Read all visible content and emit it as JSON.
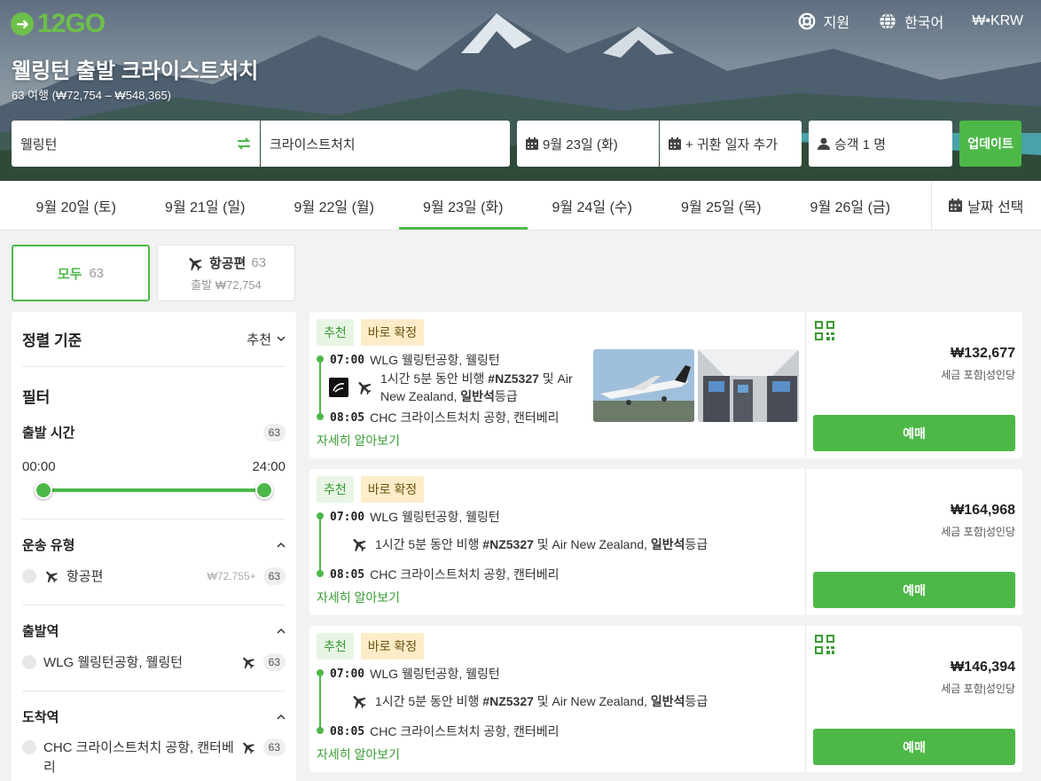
{
  "header": {
    "logo": "12GO",
    "nav": {
      "support": "지원",
      "language": "한국어",
      "currency": "₩•KRW"
    },
    "title": "웰링턴 출발 크라이스트처치",
    "subtitle": "63 여행 (₩72,754 – ₩548,365)"
  },
  "search": {
    "from": "웰링턴",
    "to": "크라이스트처치",
    "date": "9월 23일 (화)",
    "return_date": "+ 귀환 일자 추가",
    "passengers": "승객 1 명",
    "update_label": "업데이트"
  },
  "date_tabs": [
    {
      "label": "9월 20일 (토)"
    },
    {
      "label": "9월 21일 (일)"
    },
    {
      "label": "9월 22일 (월)"
    },
    {
      "label": "9월 23일 (화)"
    },
    {
      "label": "9월 24일 (수)"
    },
    {
      "label": "9월 25일 (목)"
    },
    {
      "label": "9월 26일 (금)"
    }
  ],
  "date_picker_label": "날짜 선택",
  "transport_tabs": {
    "all": {
      "label": "모두",
      "count": "63"
    },
    "air": {
      "label": "항공편",
      "count": "63",
      "from_price": "출발 ₩72,754"
    }
  },
  "filters": {
    "sort_label": "정렬 기준",
    "sort_value": "추천",
    "heading": "필터",
    "departure_time": {
      "label": "출발 시간",
      "count": "63",
      "min": "00:00",
      "max": "24:00"
    },
    "transport_type": {
      "label": "운송 유형",
      "option": "항공편",
      "price": "₩72,755+",
      "count": "63"
    },
    "departure_station": {
      "label": "출발역",
      "option": "WLG 웰링턴공항, 웰링턴",
      "count": "63"
    },
    "arrival_station": {
      "label": "도착역",
      "option": "CHC 크라이스트처치 공항, 캔터베리",
      "count": "63"
    }
  },
  "results": [
    {
      "tag_recommended": "추천",
      "tag_confirmed": "바로 확정",
      "dep_time": "07:00",
      "dep_station": "WLG 웰링턴공항, 웰링턴",
      "duration_text": "1시간 5분 동안 비행",
      "flight_no": "#NZ5327",
      "conj": "및 Air",
      "carrier_line2": "New Zealand,",
      "class": "일반석",
      "class_suffix": "등급",
      "arr_time": "08:05",
      "arr_station": "CHC 크라이스트처치 공항, 캔터베리",
      "more": "자세히 알아보기",
      "price": "₩132,677",
      "price_note": "세금 포함|성인당",
      "book": "예매"
    },
    {
      "tag_recommended": "추천",
      "tag_confirmed": "바로 확정",
      "dep_time": "07:00",
      "dep_station": "WLG 웰링턴공항, 웰링턴",
      "duration_text": "1시간 5분 동안 비행",
      "flight_no": "#NZ5327",
      "carrier": "및 Air New Zealand,",
      "class": "일반석",
      "class_suffix": "등급",
      "arr_time": "08:05",
      "arr_station": "CHC 크라이스트처치 공항, 캔터베리",
      "more": "자세히 알아보기",
      "price": "₩164,968",
      "price_note": "세금 포함|성인당",
      "book": "예매"
    },
    {
      "tag_recommended": "추천",
      "tag_confirmed": "바로 확정",
      "dep_time": "07:00",
      "dep_station": "WLG 웰링턴공항, 웰링턴",
      "duration_text": "1시간 5분 동안 비행",
      "flight_no": "#NZ5327",
      "carrier": "및 Air New Zealand,",
      "class": "일반석",
      "class_suffix": "등급",
      "arr_time": "08:05",
      "arr_station": "CHC 크라이스트처치 공항, 캔터베리",
      "more": "자세히 알아보기",
      "price": "₩146,394",
      "price_note": "세금 포함|성인당",
      "book": "예매"
    }
  ],
  "colors": {
    "brand_green": "#4db848",
    "confirm_bg": "#fdecc8",
    "recommend_bg": "#e8f5e4"
  }
}
